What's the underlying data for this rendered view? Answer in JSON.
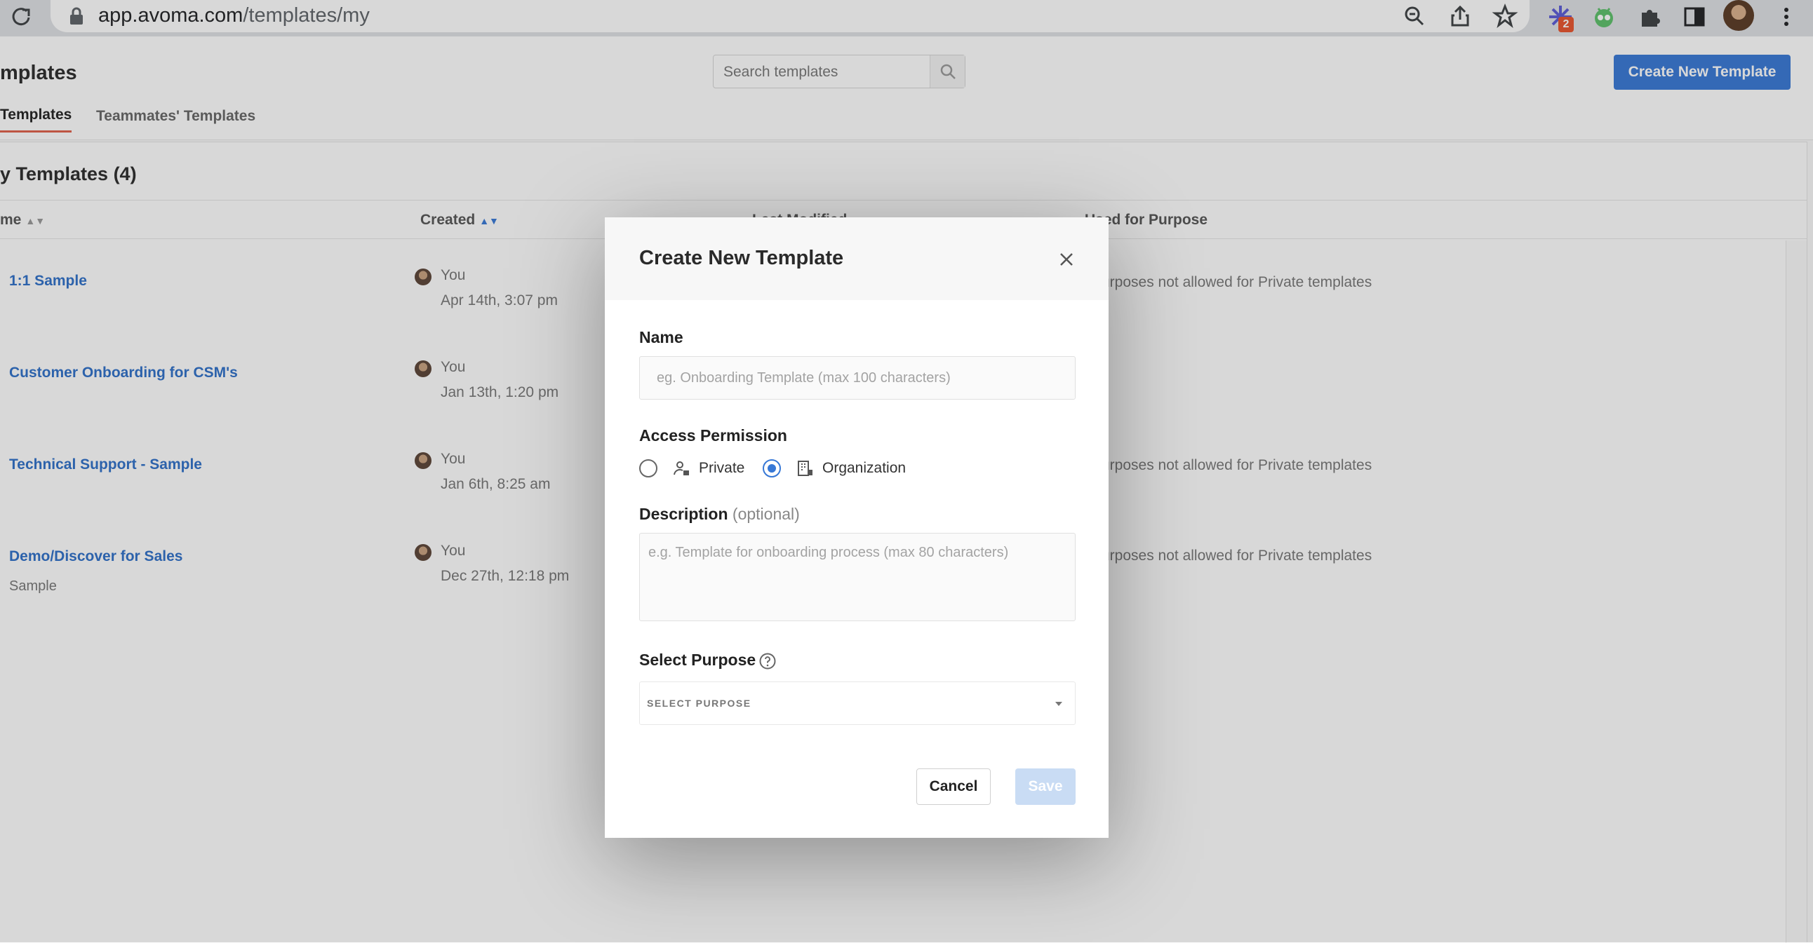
{
  "browser": {
    "url_host": "app.avoma.com",
    "url_path": "/templates/my",
    "extension_badge": "2"
  },
  "page": {
    "title": "mplates",
    "search_placeholder": "Search templates",
    "create_button": "Create New Template",
    "tabs": [
      {
        "label": "Templates",
        "active": true
      },
      {
        "label": "Teammates' Templates",
        "active": false
      }
    ],
    "section_title": "y Templates (4)",
    "columns": [
      "me",
      "Created",
      "Last Modified",
      "Used for Purpose"
    ],
    "rows": [
      {
        "name": "1:1 Sample",
        "sub": "",
        "created_by": "You",
        "created_at": "Apr 14th, 3:07 pm",
        "purpose": "urposes not allowed for Private templates"
      },
      {
        "name": "Customer Onboarding for CSM's",
        "sub": "",
        "created_by": "You",
        "created_at": "Jan 13th, 1:20 pm",
        "purpose": ""
      },
      {
        "name": "Technical Support - Sample",
        "sub": "",
        "created_by": "You",
        "created_at": "Jan 6th, 8:25 am",
        "purpose": "urposes not allowed for Private templates"
      },
      {
        "name": "Demo/Discover for Sales",
        "sub": "Sample",
        "created_by": "You",
        "created_at": "Dec 27th, 12:18 pm",
        "purpose": "urposes not allowed for Private templates"
      }
    ]
  },
  "modal": {
    "title": "Create New Template",
    "name_label": "Name",
    "name_placeholder": "eg. Onboarding Template (max 100 characters)",
    "access_label": "Access Permission",
    "access_options": [
      {
        "label": "Private",
        "selected": false
      },
      {
        "label": "Organization",
        "selected": true
      }
    ],
    "description_label": "Description",
    "description_optional": "(optional)",
    "description_placeholder": "e.g. Template for onboarding process (max 80 characters)",
    "purpose_label": "Select Purpose",
    "purpose_select_value": "SELECT PURPOSE",
    "cancel_button": "Cancel",
    "save_button": "Save"
  },
  "colors": {
    "accent": "#3778d6",
    "tab_underline": "#e0604a",
    "link": "#2e6fc9",
    "save_disabled": "#c9dcf4"
  }
}
